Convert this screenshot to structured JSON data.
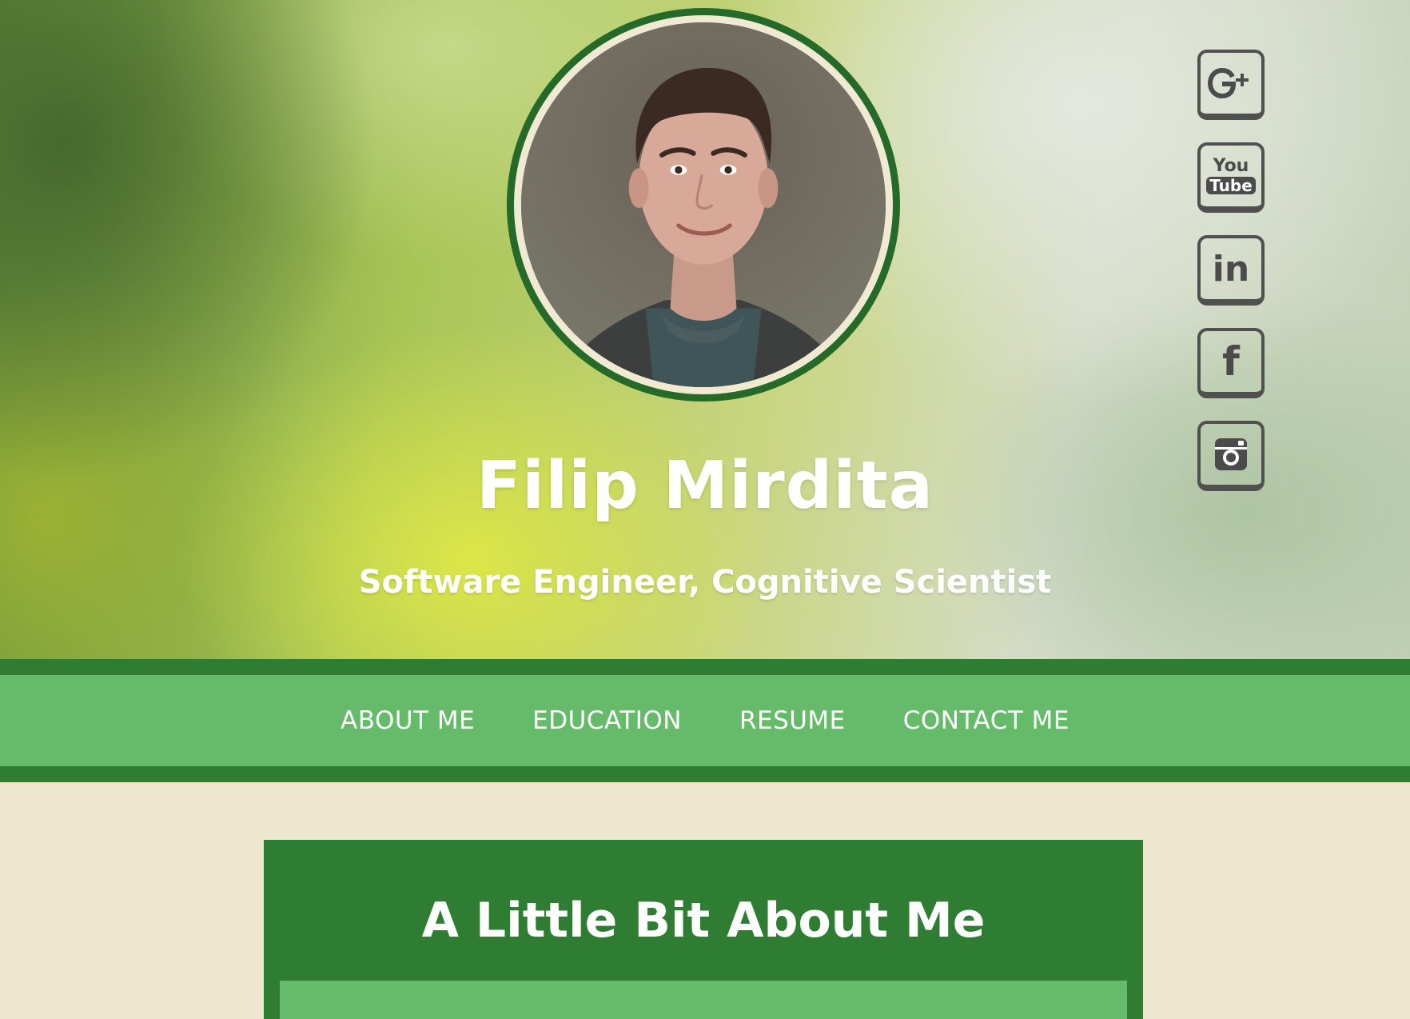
{
  "profile": {
    "name": "Filip Mirdita",
    "tagline": "Software Engineer, Cognitive Scientist",
    "photo_icon": "profile-photo"
  },
  "socials": [
    {
      "id": "google-plus",
      "label": "G+",
      "icon": "google-plus-icon"
    },
    {
      "id": "youtube",
      "label_top": "You",
      "label_bottom": "Tube",
      "icon": "youtube-icon"
    },
    {
      "id": "linkedin",
      "label": "in",
      "icon": "linkedin-icon"
    },
    {
      "id": "facebook",
      "label": "f",
      "icon": "facebook-icon"
    },
    {
      "id": "instagram",
      "icon": "instagram-icon"
    }
  ],
  "nav": {
    "items": [
      {
        "label": "ABOUT ME"
      },
      {
        "label": "EDUCATION"
      },
      {
        "label": "RESUME"
      },
      {
        "label": "CONTACT ME"
      }
    ]
  },
  "about": {
    "title": "A Little Bit About Me"
  },
  "colors": {
    "dark_green": "#2e7d32",
    "light_green": "#66bb6a",
    "cream": "#ede7cf",
    "ring": "#256a28"
  }
}
